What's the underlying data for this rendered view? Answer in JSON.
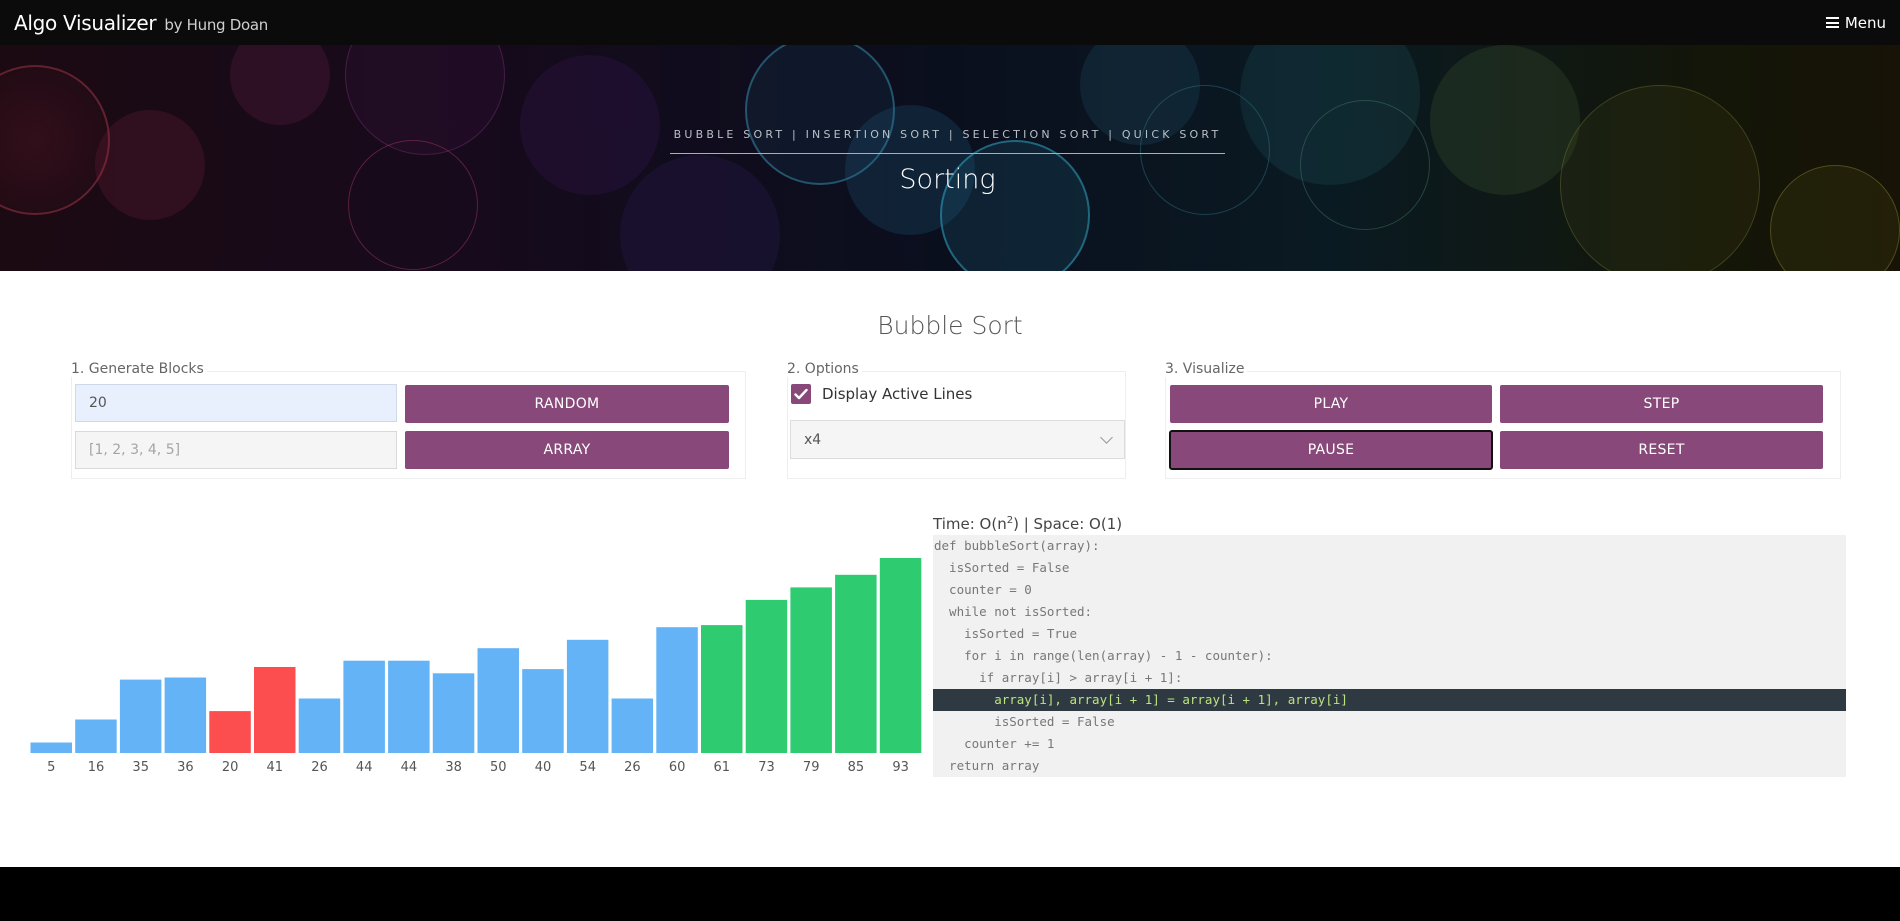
{
  "navbar": {
    "brand": "Algo Visualizer",
    "brand_by": "by Hung Doan",
    "menu_label": "Menu"
  },
  "hero": {
    "subtitle": "BUBBLE SORT | INSERTION SORT | SELECTION SORT | QUICK SORT",
    "title": "Sorting"
  },
  "page_title": "Bubble Sort",
  "generate": {
    "label": "1. Generate Blocks",
    "count_value": "20",
    "array_placeholder": "[1, 2, 3, 4, 5]",
    "random_label": "RANDOM",
    "array_label": "ARRAY"
  },
  "options": {
    "label": "2. Options",
    "display_active_lines_label": "Display Active Lines",
    "display_active_lines_checked": true,
    "speed_selected": "x4"
  },
  "visualize": {
    "label": "3. Visualize",
    "play_label": "PLAY",
    "step_label": "STEP",
    "pause_label": "PAUSE",
    "reset_label": "RESET"
  },
  "complexity": {
    "time_prefix": "Time: O(n",
    "time_exp": "2",
    "rest": ") | Space: O(1)"
  },
  "code": {
    "lines": [
      "def bubbleSort(array):",
      "  isSorted = False",
      "  counter = 0",
      "  while not isSorted:",
      "    isSorted = True",
      "    for i in range(len(array) - 1 - counter):",
      "      if array[i] > array[i + 1]:",
      "        array[i], array[i + 1] = array[i + 1], array[i]",
      "        isSorted = False",
      "    counter += 1",
      "  return array"
    ],
    "active_line_index": 7
  },
  "colors": {
    "accent": "#88497a",
    "bar_default": "#63b3f6",
    "bar_compare": "#fc4e4e",
    "bar_sorted": "#2ecb71"
  },
  "chart_data": {
    "type": "bar",
    "categories": [
      "5",
      "16",
      "35",
      "36",
      "20",
      "41",
      "26",
      "44",
      "44",
      "38",
      "50",
      "40",
      "54",
      "26",
      "60",
      "61",
      "73",
      "79",
      "85",
      "93"
    ],
    "values": [
      5,
      16,
      35,
      36,
      20,
      41,
      26,
      44,
      44,
      38,
      50,
      40,
      54,
      26,
      60,
      61,
      73,
      79,
      85,
      93
    ],
    "states": [
      "default",
      "default",
      "default",
      "default",
      "compare",
      "compare",
      "default",
      "default",
      "default",
      "default",
      "default",
      "default",
      "default",
      "default",
      "default",
      "sorted",
      "sorted",
      "sorted",
      "sorted",
      "sorted"
    ],
    "title": "",
    "xlabel": "",
    "ylabel": "",
    "ylim": [
      0,
      93
    ],
    "grid": false
  }
}
